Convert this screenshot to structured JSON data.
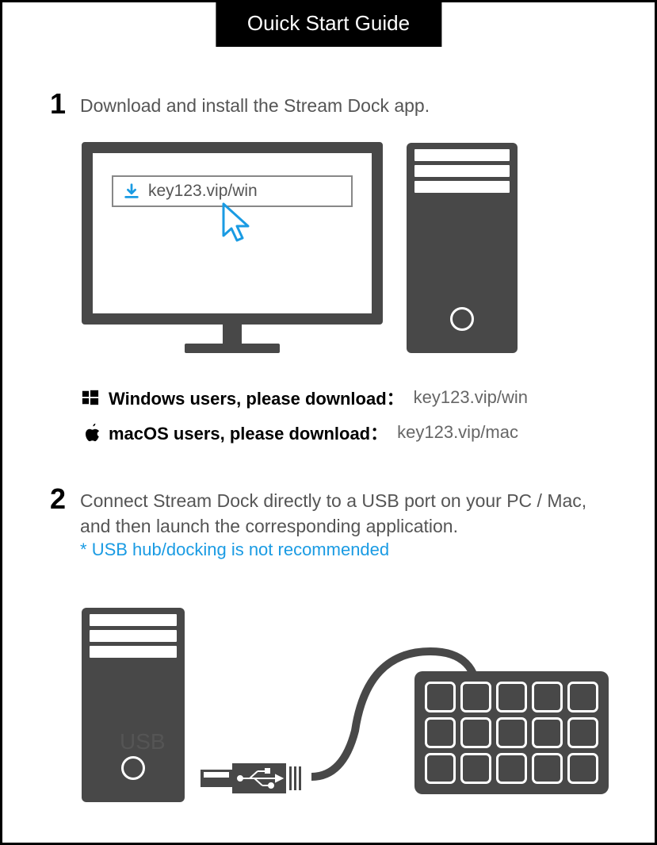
{
  "title": "Ouick Start Guide",
  "step1": {
    "number": "1",
    "text": "Download and install the Stream Dock app.",
    "url_display": "key123.vip/win"
  },
  "downloads": {
    "windows": {
      "label": "Windows users, please download：",
      "url": "key123.vip/win"
    },
    "mac": {
      "label": "macOS users, please download：",
      "url": "key123.vip/mac"
    }
  },
  "step2": {
    "number": "2",
    "text": "Connect Stream Dock directly to a USB port on your PC / Mac, and then launch the corresponding application.",
    "warning": "* USB hub/docking is not recommended"
  },
  "usb_label": "USB",
  "colors": {
    "accent_blue": "#1a9be3",
    "dark_gray": "#484848",
    "mid_gray": "#555"
  }
}
